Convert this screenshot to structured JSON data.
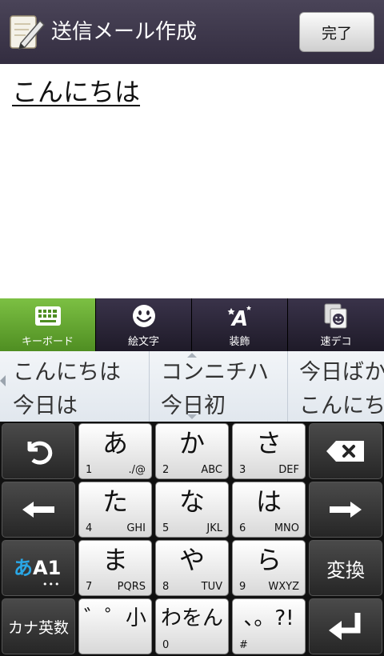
{
  "header": {
    "title": "送信メール作成",
    "done_label": "完了"
  },
  "editor": {
    "text": "こんにちは"
  },
  "tabs": [
    {
      "label": "キーボード",
      "icon": "keyboard-icon",
      "active": true
    },
    {
      "label": "絵文字",
      "icon": "smiley-icon",
      "active": false
    },
    {
      "label": "装飾",
      "icon": "decoration-icon",
      "active": false
    },
    {
      "label": "速デコ",
      "icon": "quick-deco-icon",
      "active": false
    }
  ],
  "candidates": [
    [
      "こんにちは",
      "今日は"
    ],
    [
      "コンニチハ",
      "今日初"
    ],
    [
      "今日ばか",
      "こんにち"
    ]
  ],
  "keys": {
    "a": {
      "kana": "あ",
      "num": "1",
      "sub": "./@"
    },
    "ka": {
      "kana": "か",
      "num": "2",
      "sub": "ABC"
    },
    "sa": {
      "kana": "さ",
      "num": "3",
      "sub": "DEF"
    },
    "ta": {
      "kana": "た",
      "num": "4",
      "sub": "GHI"
    },
    "na": {
      "kana": "な",
      "num": "5",
      "sub": "JKL"
    },
    "ha": {
      "kana": "は",
      "num": "6",
      "sub": "MNO"
    },
    "ma": {
      "kana": "ま",
      "num": "7",
      "sub": "PQRS"
    },
    "ya": {
      "kana": "や",
      "num": "8",
      "sub": "TUV"
    },
    "ra": {
      "kana": "ら",
      "num": "9",
      "sub": "WXYZ"
    },
    "dakuten": {
      "kana": "゛゜小",
      "num": ""
    },
    "wa": {
      "kana": "わをん",
      "num": "0"
    },
    "punct": {
      "kana": "、。?!",
      "num": "#"
    },
    "mode": {
      "kana_part": "あ",
      "alpha_part": "A1",
      "dots": "•••"
    },
    "convert": "変換",
    "kana_eisu": "カナ英数"
  },
  "colors": {
    "header_bg": "#3c3548",
    "active_tab": "#67a832",
    "mode_key_accent": "#2aa7e6"
  }
}
